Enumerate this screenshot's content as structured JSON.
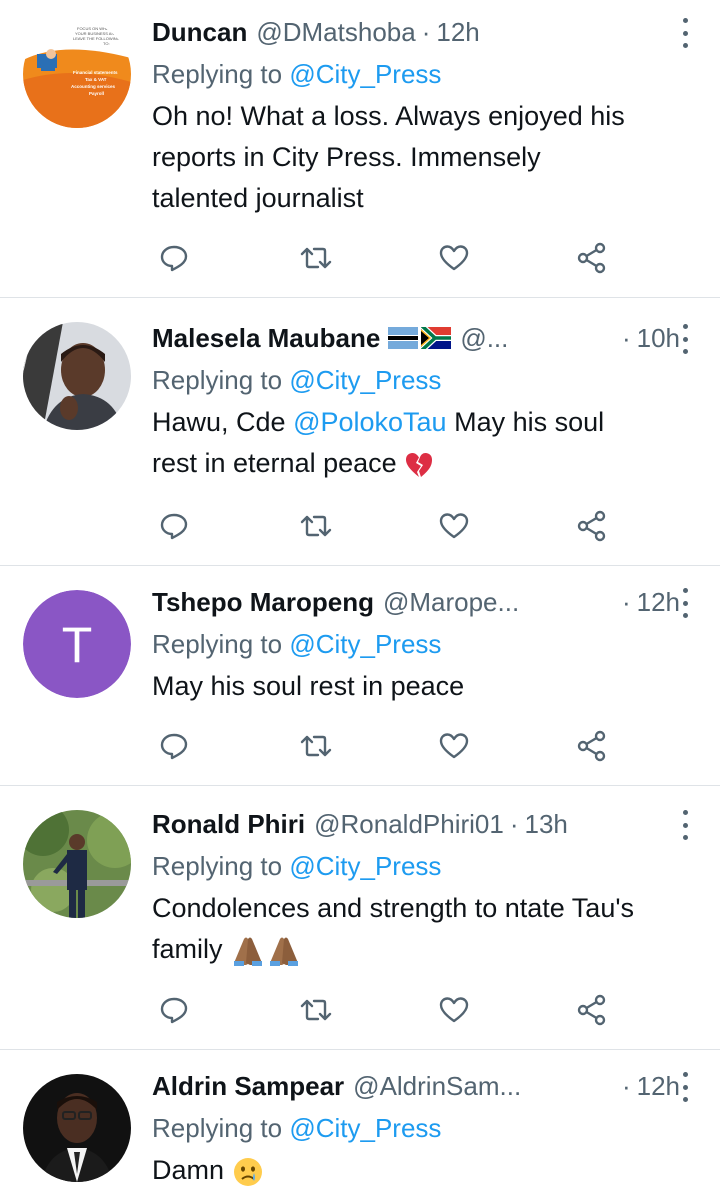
{
  "colors": {
    "text": "#0f1419",
    "secondary": "#536471",
    "link": "#1d9bf0",
    "divider": "#dfe3e7"
  },
  "tweets": [
    {
      "name": "Duncan",
      "handle": "@DMatshoba",
      "time": "12h",
      "reply_prefix": "Replying to ",
      "reply_to": "@City_Press",
      "text_lines": [
        "Oh no! What a loss. Always enjoyed his",
        "reports in City Press. Immensely",
        "talented journalist"
      ],
      "avatar": {
        "type": "logo",
        "lines": [
          "FOCUS ON WHAT",
          "YOUR BUSINESS AND",
          "LEAVE THE FOLLOWING",
          "TO:",
          "Financial statements",
          "Tax & VAT",
          "Accounting services",
          "Payroll"
        ]
      }
    },
    {
      "name": "Malesela Maubane",
      "handle": "@...",
      "time": "10h",
      "reply_prefix": "Replying to ",
      "reply_to": "@City_Press",
      "text_before": "Hawu, Cde ",
      "text_mention": "@PolokoTau",
      "text_after_line1": " May his soul",
      "text_line2": "rest in eternal peace",
      "emoji": "broken-heart-icon",
      "avatar": {
        "type": "photo"
      }
    },
    {
      "name": "Tshepo Maropeng",
      "handle": "@Marope...",
      "time": "12h",
      "reply_prefix": "Replying to ",
      "reply_to": "@City_Press",
      "text_lines": [
        "May his soul rest in peace"
      ],
      "avatar": {
        "type": "letter",
        "letter": "T",
        "color": "#8a56c5"
      }
    },
    {
      "name": "Ronald Phiri",
      "handle": "@RonaldPhiri01",
      "time": "13h",
      "reply_prefix": "Replying to ",
      "reply_to": "@City_Press",
      "text_lines": [
        "Condolences and strength to ntate Tau's",
        "family"
      ],
      "emoji": "folded-hands-icon",
      "avatar": {
        "type": "photo"
      }
    },
    {
      "name": "Aldrin Sampear",
      "handle": "@AldrinSam...",
      "time": "12h",
      "reply_prefix": "Replying to ",
      "reply_to": "@City_Press",
      "text_lines": [
        "Damn"
      ],
      "emoji": "crying-face-icon",
      "avatar": {
        "type": "photo"
      }
    }
  ],
  "separator": "·"
}
